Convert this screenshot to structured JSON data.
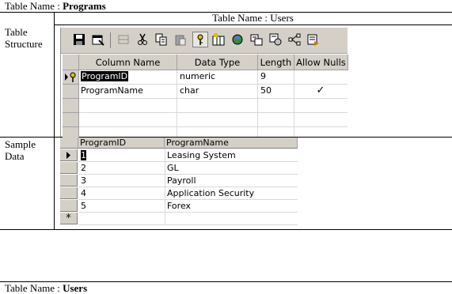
{
  "top_heading": {
    "prefix": "Table Name : ",
    "name": "Programs"
  },
  "users_header": {
    "text": "Table Name : Users"
  },
  "labels": {
    "structure_line1": "Table",
    "structure_line2": "Structure",
    "sample_line1": "Sample",
    "sample_line2": "Data"
  },
  "toolbar": {
    "icons": [
      "save-icon",
      "properties-icon",
      "cut-disabled-icon",
      "cut-icon",
      "copy-icon",
      "paste-icon",
      "primary-key-icon",
      "insert-column-icon",
      "relationships-icon",
      "indexes-icon",
      "constraints-icon",
      "diagram-icon",
      "generate-script-icon"
    ]
  },
  "structure": {
    "headers": {
      "column_name": "Column Name",
      "data_type": "Data Type",
      "length": "Length",
      "allow_nulls": "Allow Nulls"
    },
    "rows": [
      {
        "column_name": "ProgramID",
        "data_type": "numeric",
        "length": "9",
        "allow_nulls": ""
      },
      {
        "column_name": "ProgramName",
        "data_type": "char",
        "length": "50",
        "allow_nulls": "✓"
      }
    ]
  },
  "sample": {
    "headers": {
      "id": "ProgramID",
      "name": "ProgramName"
    },
    "rows": [
      {
        "id": "1",
        "name": "Leasing System"
      },
      {
        "id": "2",
        "name": "GL"
      },
      {
        "id": "3",
        "name": "Payroll"
      },
      {
        "id": "4",
        "name": "Application Security"
      },
      {
        "id": "5",
        "name": "Forex"
      }
    ],
    "new_row_marker": "*"
  },
  "bottom_heading": {
    "prefix": "Table Name : ",
    "name": "Users"
  }
}
